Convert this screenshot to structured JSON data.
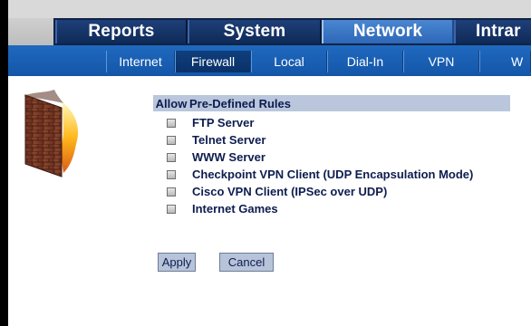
{
  "nav": {
    "main_tabs": [
      {
        "label": "Reports",
        "active": false
      },
      {
        "label": "System",
        "active": false
      },
      {
        "label": "Network",
        "active": true
      },
      {
        "label": "Intrar",
        "active": false
      }
    ],
    "sub_tabs": [
      {
        "label": "Internet",
        "active": false
      },
      {
        "label": "Firewall",
        "active": true
      },
      {
        "label": "Local",
        "active": false
      },
      {
        "label": "Dial-In",
        "active": false
      },
      {
        "label": "VPN",
        "active": false
      },
      {
        "label": "W",
        "active": false
      }
    ]
  },
  "rules": {
    "allow_label": "Allow",
    "header_label": "Pre-Defined Rules",
    "items": [
      {
        "label": "FTP Server",
        "checked": false
      },
      {
        "label": "Telnet Server",
        "checked": false
      },
      {
        "label": "WWW Server",
        "checked": false
      },
      {
        "label": "Checkpoint VPN Client (UDP Encapsulation Mode)",
        "checked": false
      },
      {
        "label": "Cisco VPN Client (IPSec over UDP)",
        "checked": false
      },
      {
        "label": "Internet Games",
        "checked": false
      }
    ]
  },
  "buttons": {
    "apply": "Apply",
    "cancel": "Cancel"
  },
  "colors": {
    "main_nav": "#0f2344",
    "active_tab": "#2d67b6",
    "sub_nav": "#1559aa",
    "header_bg": "#b9c6dc",
    "text": "#0d1d4f"
  }
}
